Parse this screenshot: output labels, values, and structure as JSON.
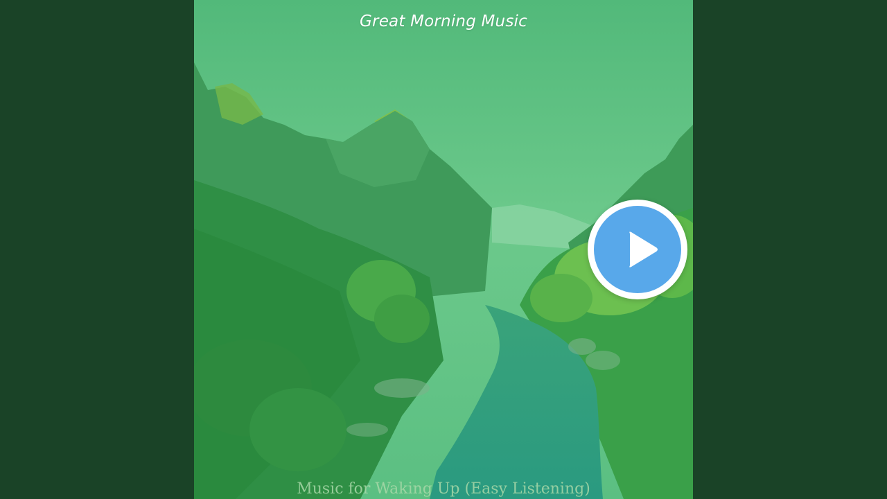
{
  "video": {
    "artist_title": "Great Morning Music",
    "album_title": "Music for Waking Up (Easy Listening)",
    "play_icon": "play-icon"
  },
  "colors": {
    "background": "#1a4327",
    "tint": "#5fc282",
    "play_button": "#58a8ea",
    "play_ring": "#ffffff"
  }
}
